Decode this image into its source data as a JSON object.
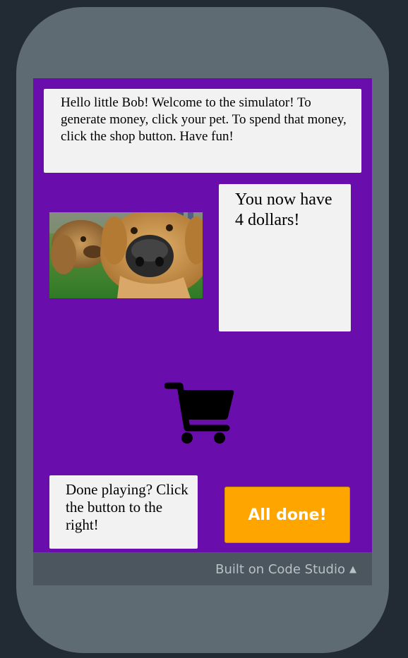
{
  "app": {
    "welcome_text": "Hello little Bob! Welcome to the simulator! To generate money, click your pet. To spend that money, click the shop button. Have fun!",
    "money_text": "You now have 4 dollars!",
    "done_text": "Done playing? Click the button to the right!",
    "done_button_label": "All done!",
    "pet_image": "dog-closeup-photo",
    "shop_icon": "shopping-cart-icon"
  },
  "footer": {
    "link_label": "Built on Code Studio",
    "caret_icon": "caret-up-icon"
  },
  "colors": {
    "screen_background": "#6a0dad",
    "button_background": "#ffa500",
    "text_box_background": "#f2f2f2",
    "phone_frame": "#5e6b72"
  }
}
